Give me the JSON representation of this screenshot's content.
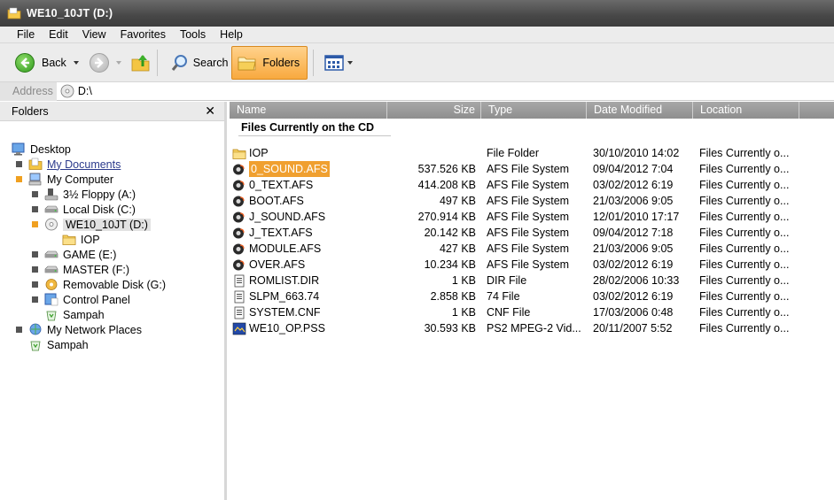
{
  "window": {
    "title": "WE10_10JT (D:)"
  },
  "menu": [
    "File",
    "Edit",
    "View",
    "Favorites",
    "Tools",
    "Help"
  ],
  "toolbar": {
    "back_label": "Back",
    "search_label": "Search",
    "folders_label": "Folders"
  },
  "address": {
    "label": "Address",
    "value": "D:\\"
  },
  "folders_pane": {
    "title": "Folders",
    "close_glyph": "✕",
    "tree": [
      {
        "label": "Desktop",
        "icon": "desktop-icon",
        "indent": 0,
        "box": "none"
      },
      {
        "label": "My Documents",
        "icon": "documents-icon",
        "indent": 1,
        "box": "gray",
        "link": true
      },
      {
        "label": "My Computer",
        "icon": "computer-icon",
        "indent": 1,
        "box": "orange"
      },
      {
        "label": "3½ Floppy (A:)",
        "icon": "floppy-icon",
        "indent": 2,
        "box": "gray"
      },
      {
        "label": "Local Disk (C:)",
        "icon": "disk-icon",
        "indent": 2,
        "box": "gray"
      },
      {
        "label": "WE10_10JT (D:)",
        "icon": "cd-icon",
        "indent": 2,
        "box": "orange",
        "selected": true
      },
      {
        "label": "IOP",
        "icon": "folder-icon",
        "indent": 3,
        "box": "none"
      },
      {
        "label": "GAME (E:)",
        "icon": "disk-icon",
        "indent": 2,
        "box": "gray"
      },
      {
        "label": "MASTER (F:)",
        "icon": "disk-icon",
        "indent": 2,
        "box": "gray"
      },
      {
        "label": "Removable Disk (G:)",
        "icon": "removable-icon",
        "indent": 2,
        "box": "gray"
      },
      {
        "label": "Control Panel",
        "icon": "control-panel-icon",
        "indent": 2,
        "box": "gray"
      },
      {
        "label": "Sampah",
        "icon": "recycle-icon",
        "indent": 2,
        "box": "none"
      },
      {
        "label": "My Network Places",
        "icon": "network-icon",
        "indent": 1,
        "box": "gray"
      },
      {
        "label": "Sampah",
        "icon": "recycle-icon",
        "indent": 1,
        "box": "none"
      }
    ]
  },
  "file_list": {
    "columns": [
      "Name",
      "Size",
      "Type",
      "Date Modified",
      "Location"
    ],
    "group_title": "Files Currently on the CD",
    "rows": [
      {
        "name": "IOP",
        "size": "",
        "type": "File Folder",
        "date": "30/10/2010 14:02",
        "location": "Files Currently o...",
        "icon": "folder-icon"
      },
      {
        "name": "0_SOUND.AFS",
        "size": "537.526 KB",
        "type": "AFS File System",
        "date": "09/04/2012 7:04",
        "location": "Files Currently o...",
        "icon": "afs-file-icon",
        "selected": true
      },
      {
        "name": "0_TEXT.AFS",
        "size": "414.208 KB",
        "type": "AFS File System",
        "date": "03/02/2012 6:19",
        "location": "Files Currently o...",
        "icon": "afs-file-icon"
      },
      {
        "name": "BOOT.AFS",
        "size": "497 KB",
        "type": "AFS File System",
        "date": "21/03/2006 9:05",
        "location": "Files Currently o...",
        "icon": "afs-file-icon"
      },
      {
        "name": "J_SOUND.AFS",
        "size": "270.914 KB",
        "type": "AFS File System",
        "date": "12/01/2010 17:17",
        "location": "Files Currently o...",
        "icon": "afs-file-icon"
      },
      {
        "name": "J_TEXT.AFS",
        "size": "20.142 KB",
        "type": "AFS File System",
        "date": "09/04/2012 7:18",
        "location": "Files Currently o...",
        "icon": "afs-file-icon"
      },
      {
        "name": "MODULE.AFS",
        "size": "427 KB",
        "type": "AFS File System",
        "date": "21/03/2006 9:05",
        "location": "Files Currently o...",
        "icon": "afs-file-icon"
      },
      {
        "name": "OVER.AFS",
        "size": "10.234 KB",
        "type": "AFS File System",
        "date": "03/02/2012 6:19",
        "location": "Files Currently o...",
        "icon": "afs-file-icon"
      },
      {
        "name": "ROMLIST.DIR",
        "size": "1 KB",
        "type": "DIR File",
        "date": "28/02/2006 10:33",
        "location": "Files Currently o...",
        "icon": "generic-file-icon"
      },
      {
        "name": "SLPM_663.74",
        "size": "2.858 KB",
        "type": "74 File",
        "date": "03/02/2012 6:19",
        "location": "Files Currently o...",
        "icon": "generic-file-icon"
      },
      {
        "name": "SYSTEM.CNF",
        "size": "1 KB",
        "type": "CNF File",
        "date": "17/03/2006 0:48",
        "location": "Files Currently o...",
        "icon": "generic-file-icon"
      },
      {
        "name": "WE10_OP.PSS",
        "size": "30.593 KB",
        "type": "PS2 MPEG-2 Vid...",
        "date": "20/11/2007 5:52",
        "location": "Files Currently o...",
        "icon": "video-file-icon"
      }
    ]
  },
  "colors": {
    "accent": "#f0a030",
    "header": "#9a9a9a",
    "titlebar": "#474747"
  }
}
